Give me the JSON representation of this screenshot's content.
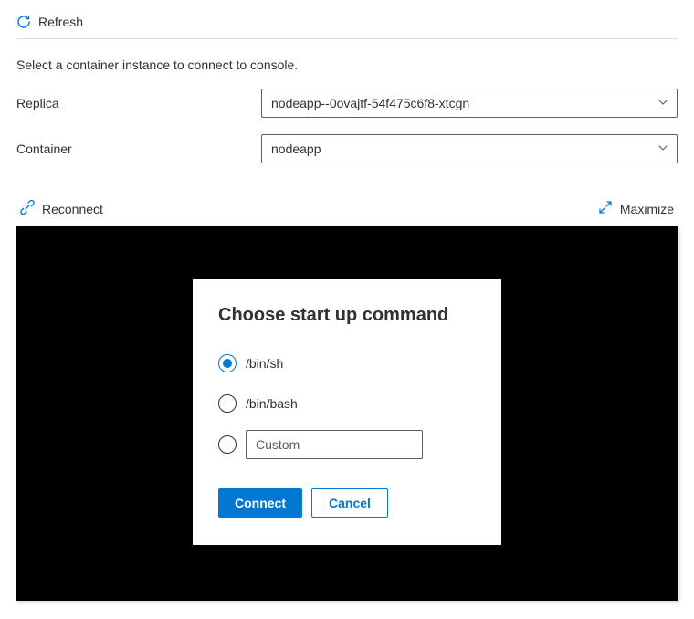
{
  "toolbar": {
    "refresh_label": "Refresh"
  },
  "instruction": "Select a container instance to connect to console.",
  "form": {
    "replica_label": "Replica",
    "replica_value": "nodeapp--0ovajtf-54f475c6f8-xtcgn",
    "container_label": "Container",
    "container_value": "nodeapp"
  },
  "actions": {
    "reconnect_label": "Reconnect",
    "maximize_label": "Maximize"
  },
  "dialog": {
    "title": "Choose start up command",
    "option_binsh": "/bin/sh",
    "option_binbash": "/bin/bash",
    "custom_placeholder": "Custom",
    "connect_label": "Connect",
    "cancel_label": "Cancel",
    "selected": "binsh"
  }
}
